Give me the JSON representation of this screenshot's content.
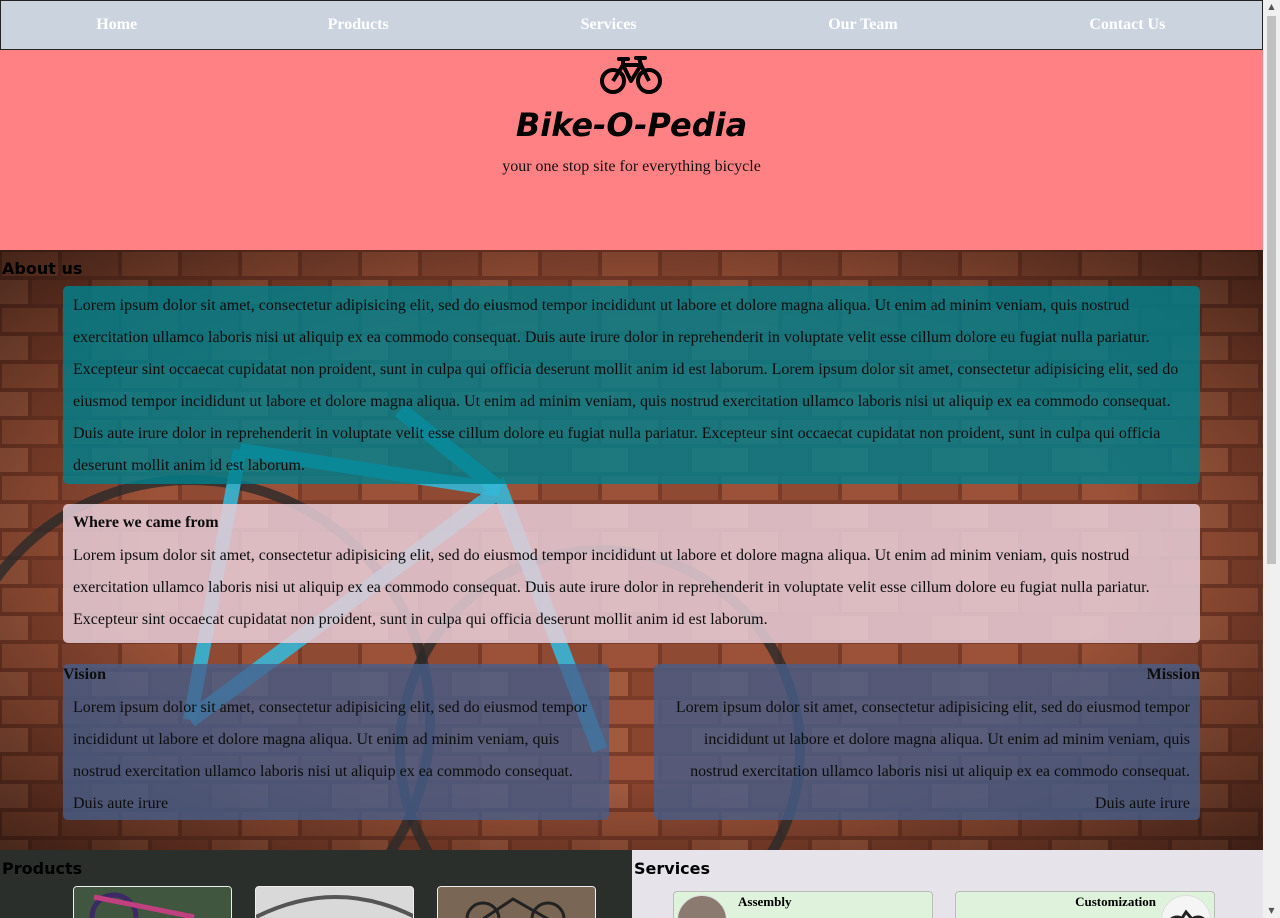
{
  "nav": {
    "items": [
      {
        "label": "Home"
      },
      {
        "label": "Products"
      },
      {
        "label": "Services"
      },
      {
        "label": "Our Team"
      },
      {
        "label": "Contact Us"
      }
    ]
  },
  "hero": {
    "logo_icon": "bicycle-icon",
    "title": "Bike-O-Pedia",
    "tagline": "your one stop site for everything bicycle",
    "background": "#ff8184"
  },
  "about": {
    "heading": "About us",
    "intro": "Lorem ipsum dolor sit amet, consectetur adipisicing elit, sed do eiusmod tempor incididunt ut labore et dolore magna aliqua. Ut enim ad minim veniam, quis nostrud exercitation ullamco laboris nisi ut aliquip ex ea commodo consequat. Duis aute irure dolor in reprehenderit in voluptate velit esse cillum dolore eu fugiat nulla pariatur. Excepteur sint occaecat cupidatat non proident, sunt in culpa qui officia deserunt mollit anim id est laborum. Lorem ipsum dolor sit amet, consectetur adipisicing elit, sed do eiusmod tempor incididunt ut labore et dolore magna aliqua. Ut enim ad minim veniam, quis nostrud exercitation ullamco laboris nisi ut aliquip ex ea commodo consequat. Duis aute irure dolor in reprehenderit in voluptate velit esse cillum dolore eu fugiat nulla pariatur. Excepteur sint occaecat cupidatat non proident, sunt in culpa qui officia deserunt mollit anim id est laborum.",
    "origin": {
      "title": "Where we came from",
      "text": "Lorem ipsum dolor sit amet, consectetur adipisicing elit, sed do eiusmod tempor incididunt ut labore et dolore magna aliqua. Ut enim ad minim veniam, quis nostrud exercitation ullamco laboris nisi ut aliquip ex ea commodo consequat. Duis aute irure dolor in reprehenderit in voluptate velit esse cillum dolore eu fugiat nulla pariatur. Excepteur sint occaecat cupidatat non proident, sunt in culpa qui officia deserunt mollit anim id est laborum."
    },
    "vision": {
      "title": "Vision",
      "text": "Lorem ipsum dolor sit amet, consectetur adipisicing elit, sed do eiusmod tempor incididunt ut labore et dolore magna aliqua. Ut enim ad minim veniam, quis nostrud exercitation ullamco laboris nisi ut aliquip ex ea commodo consequat. Duis aute irure"
    },
    "mission": {
      "title": "Mission",
      "text": "Lorem ipsum dolor sit amet, consectetur adipisicing elit, sed do eiusmod tempor incididunt ut labore et dolore magna aliqua. Ut enim ad minim veniam, quis nostrud exercitation ullamco laboris nisi ut aliquip ex ea commodo consequat. Duis aute irure"
    }
  },
  "products": {
    "heading": "Products"
  },
  "services": {
    "heading": "Services",
    "cards": [
      {
        "label": "Assembly"
      },
      {
        "label": "Customization"
      }
    ]
  }
}
